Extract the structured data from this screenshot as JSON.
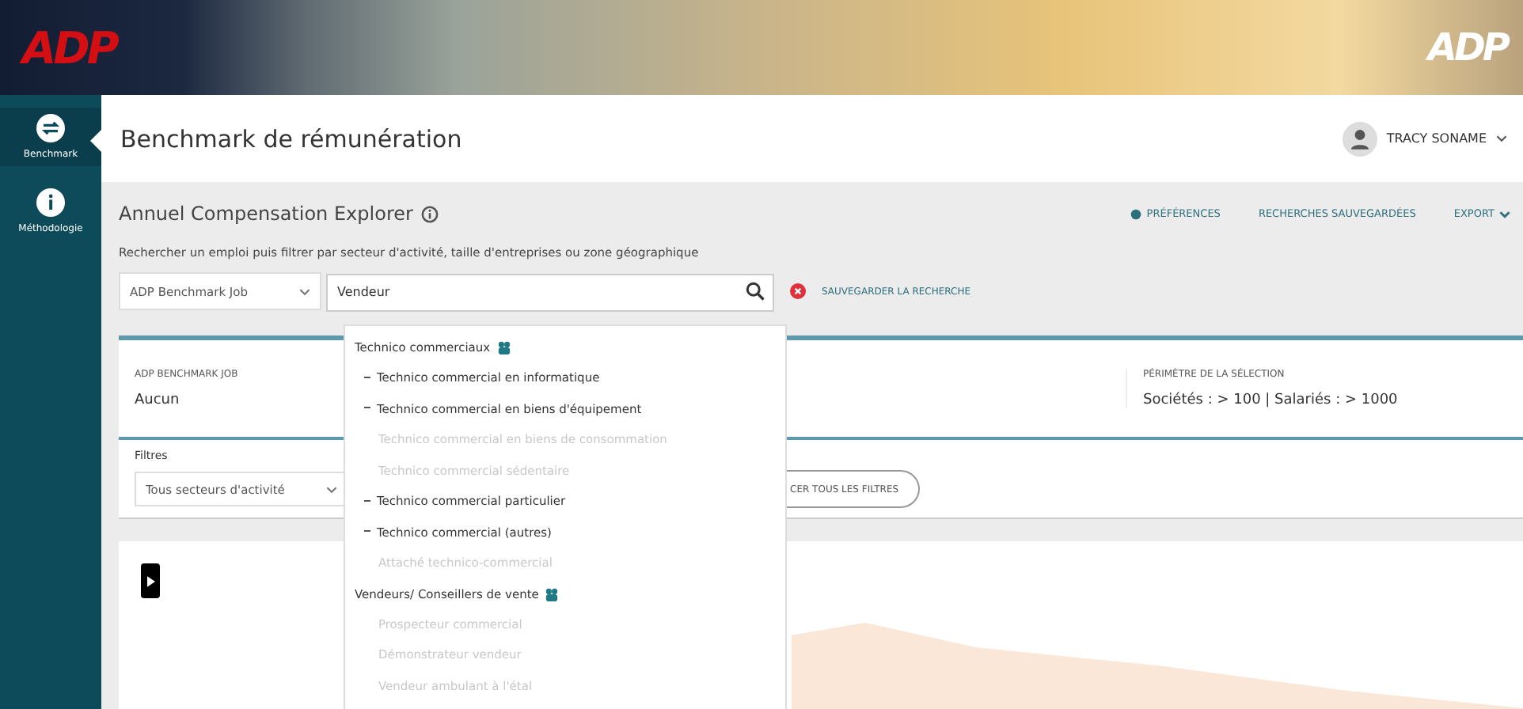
{
  "header": {
    "logo": "ADP",
    "logo_right": "ADP"
  },
  "sidebar": {
    "items": [
      {
        "label": "Benchmark",
        "kind": "swap",
        "selected": true
      },
      {
        "label": "Méthodologie",
        "kind": "info",
        "selected": false
      }
    ]
  },
  "title_bar": {
    "title": "Benchmark de rémunération",
    "user": "TRACY SONAME"
  },
  "explorer": {
    "title": "Annuel Compensation Explorer",
    "links": [
      {
        "label": "PRÉFÉRENCES",
        "kind": "gear"
      },
      {
        "label": "RECHERCHES SAUVEGARDÉES",
        "kind": "plain"
      },
      {
        "label": "EXPORT",
        "kind": "caret"
      }
    ],
    "description": "Rechercher un emploi puis filtrer par secteur d'activité, taille d'entreprises ou zone géographique",
    "job_select": "ADP Benchmark Job",
    "search": {
      "value": "Vendeur"
    },
    "save_search": "SAUVEGARDER LA RECHERCHE"
  },
  "summary": {
    "job_label": "ADP BENCHMARK JOB",
    "job_value": "Aucun",
    "scope_label": "PÉRIMÈTRE DE LA SÉLECTION",
    "scope_value": "Sociétés : > 100 | Salariés : > 1000"
  },
  "filters": {
    "label": "Filtres",
    "sector_select": "Tous secteurs d'activité",
    "clear_button": "CER TOUS LES FILTRES"
  },
  "dropdown": {
    "groups": [
      {
        "label": "Technico commerciaux",
        "items": [
          {
            "label": "Technico commercial en informatique",
            "disabled": false
          },
          {
            "label": "Technico commercial en biens d'équipement",
            "disabled": false
          },
          {
            "label": "Technico commercial en biens de consommation",
            "disabled": true
          },
          {
            "label": "Technico commercial sédentaire",
            "disabled": true
          },
          {
            "label": "Technico commercial particulier",
            "disabled": false
          },
          {
            "label": "Technico commercial (autres)",
            "disabled": false
          },
          {
            "label": "Attaché technico-commercial",
            "disabled": true
          }
        ]
      },
      {
        "label": "Vendeurs/ Conseillers de vente",
        "items": [
          {
            "label": "Prospecteur commercial",
            "disabled": true
          },
          {
            "label": "Démonstrateur vendeur",
            "disabled": true
          },
          {
            "label": "Vendeur ambulant à l'étal",
            "disabled": true
          }
        ]
      }
    ]
  }
}
